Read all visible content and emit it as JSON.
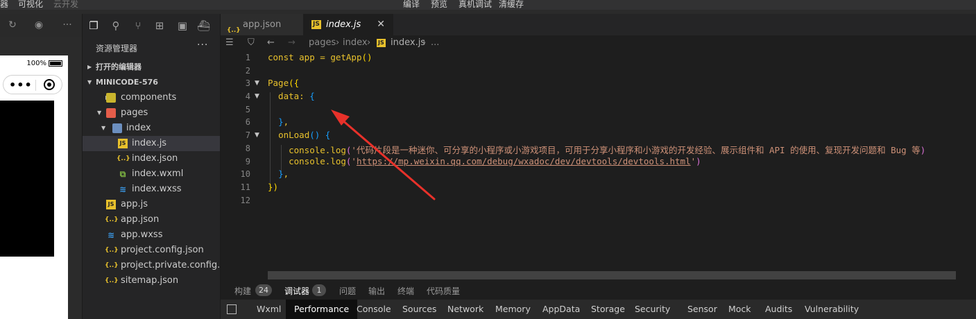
{
  "topbar": {
    "left1": "器",
    "left2": "可视化",
    "left3": "云开发",
    "items": [
      "编译",
      "预览",
      "真机调试",
      "清缓存"
    ]
  },
  "simulator": {
    "battery": "100%",
    "capsule_dots": "•••"
  },
  "explorer": {
    "title": "资源管理器",
    "more": "···",
    "open_editors": "打开的编辑器",
    "project": "MINICODE-576",
    "tree": [
      {
        "label": "components"
      },
      {
        "label": "pages"
      },
      {
        "label": "index"
      },
      {
        "label": "index.js"
      },
      {
        "label": "index.json"
      },
      {
        "label": "index.wxml"
      },
      {
        "label": "index.wxss"
      },
      {
        "label": "app.js"
      },
      {
        "label": "app.json"
      },
      {
        "label": "app.wxss"
      },
      {
        "label": "project.config.json"
      },
      {
        "label": "project.private.config.js..."
      },
      {
        "label": "sitemap.json"
      }
    ]
  },
  "tabs": [
    {
      "label": "app.json",
      "icon": "{..}"
    },
    {
      "label": "index.js",
      "icon": "JS",
      "close": "✕"
    }
  ],
  "breadcrumb": [
    "pages",
    "index",
    "index.js",
    "..."
  ],
  "editor": {
    "line_numbers": [
      "1",
      "2",
      "3",
      "4",
      "5",
      "6",
      "7",
      "8",
      "9",
      "10",
      "11",
      "12"
    ],
    "line1": {
      "a": "const app = ",
      "b": "getApp",
      "c": "()"
    },
    "line3": {
      "a": "Page",
      "b": "({"
    },
    "line4": {
      "a": "  data: ",
      "b": "{"
    },
    "line6": {
      "a": "  ",
      "b": "}",
      "c": ","
    },
    "line7": {
      "a": "  ",
      "b": "onLoad",
      "c": "() ",
      "d": "{"
    },
    "line8": {
      "a": "    console.",
      "b": "log",
      "c": "(",
      "d": "'代码片段是一种迷你、可分享的小程序或小游戏项目，可用于分享小程序和小游戏的开发经验、展示组件和 API 的使用、复现开发问题和 Bug 等",
      "e": ")"
    },
    "line9": {
      "a": "    console.",
      "b": "log",
      "c": "(",
      "d": "'",
      "e": "https://mp.weixin.qq.com/debug/wxadoc/dev/devtools/devtools.html",
      "f": "'",
      "g": ")"
    },
    "line10": {
      "a": "  ",
      "b": "}",
      "c": ","
    },
    "line11": {
      "a": "}",
      "b": ")"
    }
  },
  "panel_tabs": [
    {
      "label": "构建",
      "badge": "24"
    },
    {
      "label": "调试器",
      "badge": "1"
    },
    {
      "label": "问题"
    },
    {
      "label": "输出"
    },
    {
      "label": "终端"
    },
    {
      "label": "代码质量"
    }
  ],
  "devtools_tabs": [
    "Wxml",
    "Performance",
    "Console",
    "Sources",
    "Network",
    "Memory",
    "AppData",
    "Storage",
    "Security",
    "Sensor",
    "Mock",
    "Audits",
    "Vulnerability"
  ],
  "colors": {
    "annotation_arrow": "#e8312a"
  }
}
